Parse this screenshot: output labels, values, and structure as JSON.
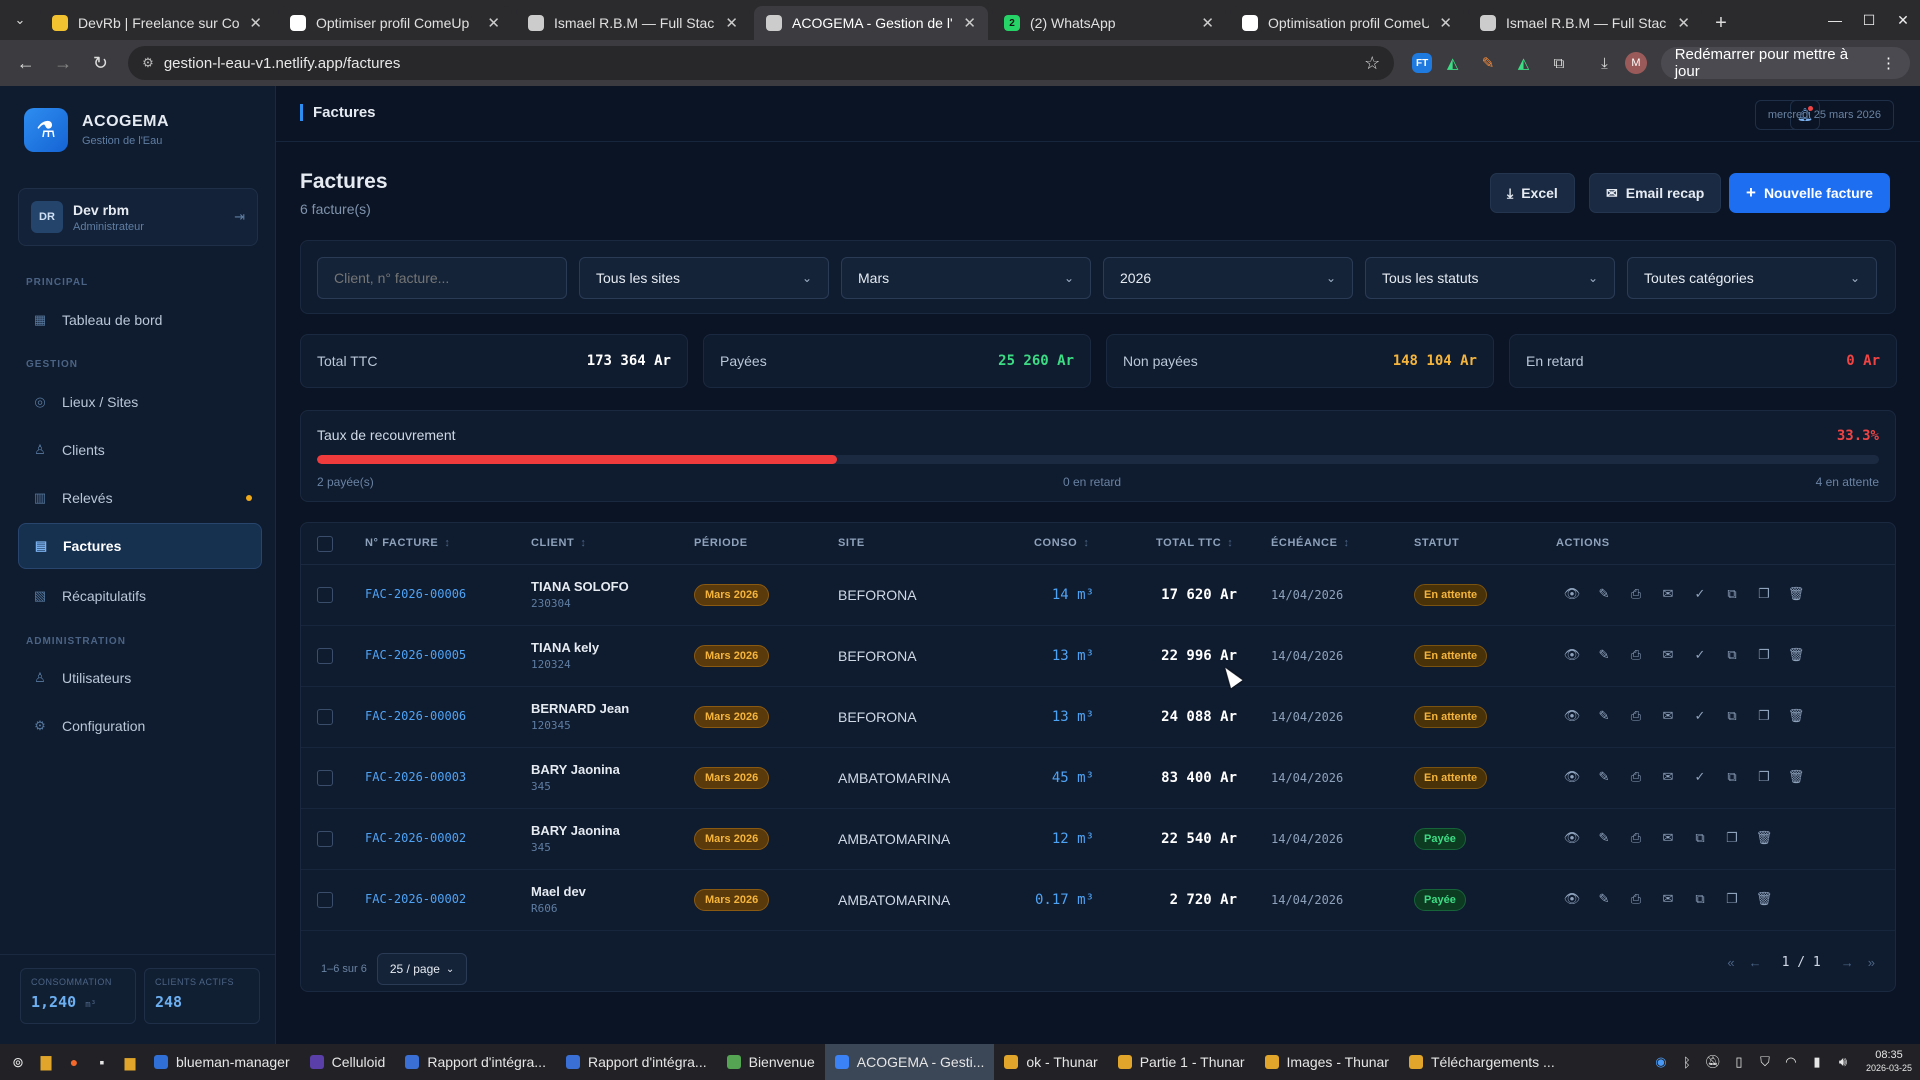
{
  "browser": {
    "tabs": [
      {
        "title": "DevRb | Freelance sur ComeUp",
        "fav": "#f2c230",
        "active": false
      },
      {
        "title": "Optimiser profil ComeUp",
        "fav": "#ffffff",
        "active": false
      },
      {
        "title": "Ismael R.B.M — Full Stack Dev",
        "fav": "#cccccc",
        "active": false
      },
      {
        "title": "ACOGEMA - Gestion de l'Eau",
        "fav": "#cccccc",
        "active": true
      },
      {
        "title": "(2) WhatsApp",
        "fav": "#25d366",
        "badge": "2",
        "active": false
      },
      {
        "title": "Optimisation profil ComeUp",
        "fav": "#ffffff",
        "active": false
      },
      {
        "title": "Ismael R.B.M — Full Stack Dev",
        "fav": "#cccccc",
        "active": false
      }
    ],
    "url": "gestion-l-eau-v1.netlify.app/factures",
    "restart_label": "Redémarrer pour mettre à jour",
    "profile_initial": "M"
  },
  "sidebar": {
    "brand_name": "ACOGEMA",
    "brand_sub": "Gestion de l'Eau",
    "user": {
      "initials": "DR",
      "name": "Dev rbm",
      "role": "Administrateur"
    },
    "sections": {
      "principal": "PRINCIPAL",
      "gestion": "GESTION",
      "admin": "ADMINISTRATION"
    },
    "items": [
      {
        "label": "Tableau de bord",
        "icon": "dashboard-icon"
      },
      {
        "label": "Lieux / Sites",
        "icon": "location-icon"
      },
      {
        "label": "Clients",
        "icon": "users-icon"
      },
      {
        "label": "Relevés",
        "icon": "chart-icon"
      },
      {
        "label": "Factures",
        "icon": "invoice-icon"
      },
      {
        "label": "Récapitulatifs",
        "icon": "summary-icon"
      },
      {
        "label": "Utilisateurs",
        "icon": "user-icon"
      },
      {
        "label": "Configuration",
        "icon": "gear-icon"
      }
    ],
    "stats": [
      {
        "label": "CONSOMMATION",
        "value": "1,240",
        "unit": "m³"
      },
      {
        "label": "CLIENTS ACTIFS",
        "value": "248"
      }
    ]
  },
  "topbar": {
    "breadcrumb": "Factures",
    "date": "mercredi 25 mars 2026"
  },
  "page": {
    "title": "Factures",
    "subtitle": "6 facture(s)",
    "btn_excel": "Excel",
    "btn_email": "Email recap",
    "btn_new": "Nouvelle facture"
  },
  "filters": {
    "search_placeholder": "Client, n° facture...",
    "site": "Tous les sites",
    "month": "Mars",
    "year": "2026",
    "status": "Tous les statuts",
    "category": "Toutes catégories"
  },
  "kpis": [
    {
      "label": "Total TTC",
      "value": "173 364  Ar",
      "color": "#ffffff"
    },
    {
      "label": "Payées",
      "value": "25 260  Ar",
      "color": "#3ddc84"
    },
    {
      "label": "Non payées",
      "value": "148 104  Ar",
      "color": "#f5b53c"
    },
    {
      "label": "En retard",
      "value": "0  Ar",
      "color": "#ef4444"
    }
  ],
  "recovery": {
    "label": "Taux de recouvrement",
    "percent_text": "33.3%",
    "fraction": 0.333,
    "paid": "2 payée(s)",
    "late": "0 en retard",
    "pending": "4 en attente"
  },
  "table": {
    "headers": {
      "invoice": "N° FACTURE",
      "client": "CLIENT",
      "period": "PÉRIODE",
      "site": "SITE",
      "conso": "CONSO",
      "total": "TOTAL TTC",
      "due": "ÉCHÉANCE",
      "status": "STATUT",
      "actions": "ACTIONS"
    },
    "rows": [
      {
        "invoice": "FAC-2026-00006",
        "client": "TIANA SOLOFO",
        "client_id": "230304",
        "period": "Mars 2026",
        "site": "BEFORONA",
        "conso": "14  m³",
        "total": "17 620  Ar",
        "due": "14/04/2026",
        "status": "En attente",
        "paid": false
      },
      {
        "invoice": "FAC-2026-00005",
        "client": "TIANA kely",
        "client_id": "120324",
        "period": "Mars 2026",
        "site": "BEFORONA",
        "conso": "13  m³",
        "total": "22 996  Ar",
        "due": "14/04/2026",
        "status": "En attente",
        "paid": false
      },
      {
        "invoice": "FAC-2026-00006",
        "client": "BERNARD Jean",
        "client_id": "120345",
        "period": "Mars 2026",
        "site": "BEFORONA",
        "conso": "13  m³",
        "total": "24 088  Ar",
        "due": "14/04/2026",
        "status": "En attente",
        "paid": false
      },
      {
        "invoice": "FAC-2026-00003",
        "client": "BARY Jaonina",
        "client_id": "345",
        "period": "Mars 2026",
        "site": "AMBATOMARINA",
        "conso": "45  m³",
        "total": "83 400  Ar",
        "due": "14/04/2026",
        "status": "En attente",
        "paid": false
      },
      {
        "invoice": "FAC-2026-00002",
        "client": "BARY Jaonina",
        "client_id": "345",
        "period": "Mars 2026",
        "site": "AMBATOMARINA",
        "conso": "12  m³",
        "total": "22 540  Ar",
        "due": "14/04/2026",
        "status": "Payée",
        "paid": true
      },
      {
        "invoice": "FAC-2026-00002",
        "client": "Mael dev",
        "client_id": "R606",
        "period": "Mars 2026",
        "site": "AMBATOMARINA",
        "conso": "0.17  m³",
        "total": "2 720  Ar",
        "due": "14/04/2026",
        "status": "Payée",
        "paid": true
      }
    ],
    "range": "1–6 sur 6",
    "per_page": "25 / page",
    "page_info": "1 / 1"
  },
  "taskbar": {
    "items": [
      {
        "label": "blueman-manager",
        "color": "#2f6fd6",
        "active": false
      },
      {
        "label": "Celluloid",
        "color": "#5a3fa8",
        "active": false
      },
      {
        "label": "Rapport d'intégra...",
        "color": "#3a6fd6",
        "active": false
      },
      {
        "label": "Rapport d'intégra...",
        "color": "#3a6fd6",
        "active": false
      },
      {
        "label": "Bienvenue",
        "color": "#54a454",
        "active": false
      },
      {
        "label": "ACOGEMA - Gesti...",
        "color": "#3b82f6",
        "active": true
      },
      {
        "label": "ok - Thunar",
        "color": "#e0a52a",
        "active": false
      },
      {
        "label": "Partie 1 - Thunar",
        "color": "#e0a52a",
        "active": false
      },
      {
        "label": "Images - Thunar",
        "color": "#e0a52a",
        "active": false
      },
      {
        "label": "Téléchargements ...",
        "color": "#e0a52a",
        "active": false
      }
    ],
    "time": "08:35",
    "date": "2026-03-25"
  }
}
